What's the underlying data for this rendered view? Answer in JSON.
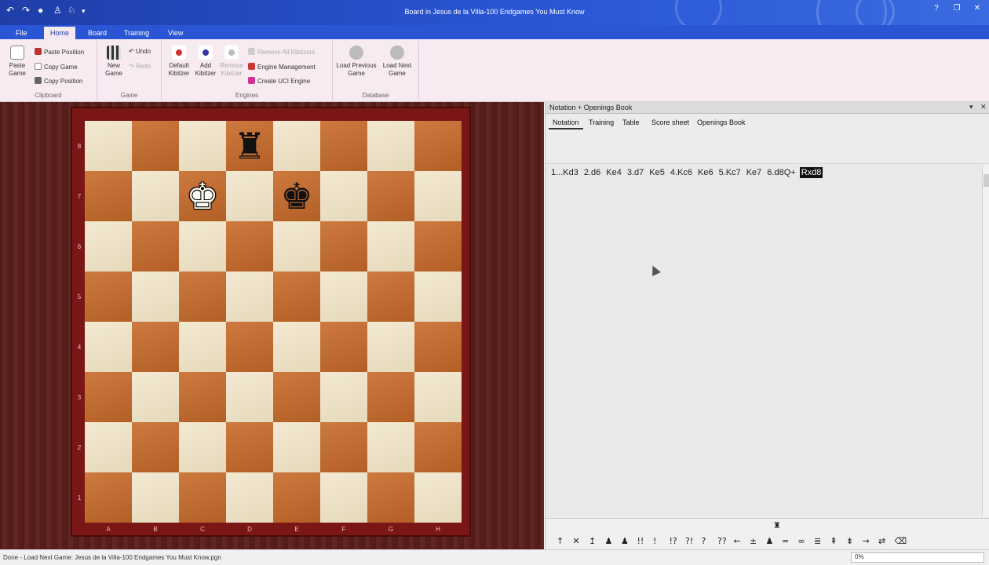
{
  "window": {
    "title": "Board in Jesus de la Villa-100 Endgames You Must Know",
    "quick_access_icons": [
      "undo-icon",
      "redo-icon",
      "save-icon",
      "pawn-icon",
      "knight-icon",
      "customize-icon"
    ],
    "controls": [
      "help-icon",
      "restore-icon",
      "close-icon"
    ]
  },
  "tabs": [
    {
      "label": "File",
      "active": false
    },
    {
      "label": "Home",
      "active": true
    },
    {
      "label": "Board",
      "active": false
    },
    {
      "label": "Training",
      "active": false
    },
    {
      "label": "View",
      "active": false
    }
  ],
  "ribbon": {
    "clipboard": {
      "label": "Clipboard",
      "paste_game": "Paste Game",
      "paste_position": "Paste Position",
      "copy_game": "Copy Game",
      "copy_position": "Copy Position"
    },
    "game": {
      "label": "Game",
      "new_game": "New Game",
      "undo": "Undo",
      "redo": "Redo"
    },
    "engines": {
      "label": "Engines",
      "default_kibitzer": "Default Kibitzer",
      "add_kibitzer": "Add Kibitzer",
      "remove_kibitzer": "Remove Kibitzer",
      "remove_all_kibitzers": "Remove All Kibitzers",
      "engine_management": "Engine Management",
      "create_uci_engine": "Create UCI Engine"
    },
    "database": {
      "label": "Database",
      "load_previous_game": "Load Previous Game",
      "load_next_game": "Load Next Game"
    }
  },
  "board": {
    "ranks": [
      "8",
      "7",
      "6",
      "5",
      "4",
      "3",
      "2",
      "1"
    ],
    "files": [
      "A",
      "B",
      "C",
      "D",
      "E",
      "F",
      "G",
      "H"
    ],
    "pieces": [
      {
        "square": "d8",
        "piece": "rook",
        "color": "black",
        "glyph": "♜"
      },
      {
        "square": "c7",
        "piece": "king",
        "color": "white",
        "glyph": "♚"
      },
      {
        "square": "e7",
        "piece": "king",
        "color": "black",
        "glyph": "♚"
      }
    ],
    "light_color": "#efe2c3",
    "dark_color": "#c76a2a"
  },
  "panel": {
    "title": "Notation + Openings Book",
    "tabs": [
      "Notation",
      "Training",
      "Table",
      "Score sheet",
      "Openings Book"
    ],
    "active_tab": "Notation",
    "moves": [
      "1...Kd3",
      "2.d6",
      "Ke4",
      "3.d7",
      "Ke5",
      "4.Kc6",
      "Ke6",
      "5.Kc7",
      "Ke7",
      "6.d8Q+",
      "Rxd8"
    ],
    "current_move": "Rxd8",
    "bottom_tool_icons": [
      "↑",
      "✕",
      "↥",
      "♟",
      "♟",
      "!!",
      "!",
      "!?",
      "?!",
      "?",
      "??",
      "←",
      "±",
      "♟",
      "=",
      "∞",
      "≣",
      "⇞",
      "⇟",
      "→",
      "⇄",
      "⌫"
    ],
    "bottom_top_icon": "♜"
  },
  "status": {
    "text": "Done - Load Next Game: Jesus de la Villa-100 Endgames You Must Know.pgn",
    "zoom": "0%"
  }
}
